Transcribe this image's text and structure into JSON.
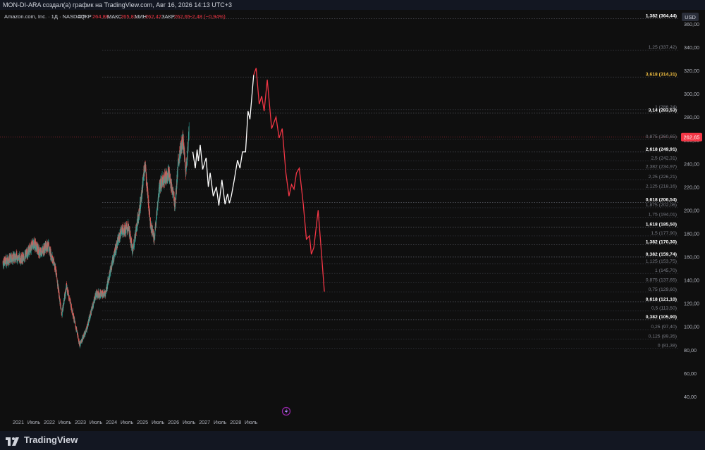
{
  "header": {
    "text": "MON-DI-ARA создал(а) график на TradingView.com, Авг 16, 2026 14:13 UTC+3"
  },
  "legend": {
    "symbol": "Amazon.com, Inc. · 1Д · NASDAQ",
    "open_label": "ОТКР",
    "open_value": "264,88",
    "high_label": "МАКС",
    "high_value": "265,81",
    "low_label": "МИН",
    "low_value": "262,42",
    "close_label": "ЗАКР",
    "close_value": "262,65",
    "change": "−2,48 (−0,94%)"
  },
  "brand": {
    "name": "TradingView"
  },
  "colors": {
    "up": "#26a69a",
    "down": "#ef5350",
    "projection_up": "#ffffff",
    "projection_down": "#f23645",
    "grid_level": "#5d606b",
    "price_badge": "#f23645",
    "golden_label": "#f5c242"
  },
  "chart_data": {
    "type": "line",
    "currency": "USD",
    "ylim": [
      20,
      372
    ],
    "y_ticks": [
      "40,00",
      "60,00",
      "80,00",
      "100,00",
      "120,00",
      "140,00",
      "160,00",
      "180,00",
      "200,00",
      "220,00",
      "240,00",
      "260,00",
      "280,00",
      "300,00",
      "320,00",
      "340,00",
      "360,00"
    ],
    "y_tick_values": [
      40,
      60,
      80,
      100,
      120,
      140,
      160,
      180,
      200,
      220,
      240,
      260,
      280,
      300,
      320,
      340,
      360
    ],
    "x_axis": {
      "range": [
        2020.5,
        2029.5
      ],
      "ticks": [
        {
          "label": "2021",
          "t": 2021.0
        },
        {
          "label": "Июль",
          "t": 2021.5
        },
        {
          "label": "2022",
          "t": 2022.0
        },
        {
          "label": "Июль",
          "t": 2022.5
        },
        {
          "label": "2023",
          "t": 2023.0
        },
        {
          "label": "Июль",
          "t": 2023.5
        },
        {
          "label": "2024",
          "t": 2024.0
        },
        {
          "label": "Июль",
          "t": 2024.5
        },
        {
          "label": "2025",
          "t": 2025.0
        },
        {
          "label": "Июль",
          "t": 2025.5
        },
        {
          "label": "2026",
          "t": 2026.0
        },
        {
          "label": "Июль",
          "t": 2026.5
        },
        {
          "label": "2027",
          "t": 2027.0
        },
        {
          "label": "Июль",
          "t": 2027.5
        },
        {
          "label": "2028",
          "t": 2028.0
        },
        {
          "label": "Июль",
          "t": 2028.5
        }
      ]
    },
    "last_price": {
      "label": "262,65",
      "value": 262.65
    },
    "fib_levels": [
      {
        "label": "1,382 (364,44)",
        "value": 364.44,
        "style": "bold"
      },
      {
        "label": "1,25 (337,42)",
        "value": 337.42,
        "style": "dim"
      },
      {
        "label": "3,618 (314,31)",
        "value": 314.31,
        "style": "gold"
      },
      {
        "label": "1 (286,24)",
        "value": 286.24,
        "style": "dim"
      },
      {
        "label": "3,14 (283,53)",
        "value": 283.53,
        "style": "bold"
      },
      {
        "label": "0,875 (260,65)",
        "value": 260.65,
        "style": "dim"
      },
      {
        "label": "2,618 (249,91)",
        "value": 249.91,
        "style": "bold"
      },
      {
        "label": "2,5 (242,31)",
        "value": 242.31,
        "style": "dim"
      },
      {
        "label": "2,382 (234,97)",
        "value": 234.97,
        "style": "dim"
      },
      {
        "label": "2,25 (226,21)",
        "value": 226.21,
        "style": "dim"
      },
      {
        "label": "2,125 (218,16)",
        "value": 218.16,
        "style": "dim"
      },
      {
        "label": "0,618 (206,54)",
        "value": 206.54,
        "style": "bold"
      },
      {
        "label": "1,875 (202,06)",
        "value": 202.06,
        "style": "dim"
      },
      {
        "label": "1,75 (194,01)",
        "value": 194.01,
        "style": "dim"
      },
      {
        "label": "1,618 (185,50)",
        "value": 185.5,
        "style": "bold"
      },
      {
        "label": "1,5 (177,90)",
        "value": 177.9,
        "style": "dim"
      },
      {
        "label": "1,382 (170,30)",
        "value": 170.3,
        "style": "bold"
      },
      {
        "label": "0,382 (159,74)",
        "value": 159.74,
        "style": "bold"
      },
      {
        "label": "1,125 (153,75)",
        "value": 153.75,
        "style": "dim"
      },
      {
        "label": "1 (145,70)",
        "value": 145.7,
        "style": "dim"
      },
      {
        "label": "0,875 (137,65)",
        "value": 137.65,
        "style": "dim"
      },
      {
        "label": "0,75 (129,60)",
        "value": 129.6,
        "style": "dim"
      },
      {
        "label": "0,618 (121,10)",
        "value": 121.1,
        "style": "bold"
      },
      {
        "label": "0,5 (113,50)",
        "value": 113.5,
        "style": "dim"
      },
      {
        "label": "0,382 (105,90)",
        "value": 105.9,
        "style": "bold"
      },
      {
        "label": "0,25 (97,40)",
        "value": 97.4,
        "style": "dim"
      },
      {
        "label": "0,125 (89,35)",
        "value": 89.35,
        "style": "dim"
      },
      {
        "label": "0 (81,38)",
        "value": 81.38,
        "style": "dim"
      }
    ],
    "series": [
      {
        "name": "",
        "kind": "candles",
        "anchors": [
          {
            "t": 2020.5,
            "v": 155
          },
          {
            "t": 2020.9,
            "v": 160
          },
          {
            "t": 2021.15,
            "v": 158
          },
          {
            "t": 2021.5,
            "v": 172
          },
          {
            "t": 2021.7,
            "v": 163
          },
          {
            "t": 2021.95,
            "v": 170
          },
          {
            "t": 2022.2,
            "v": 150
          },
          {
            "t": 2022.4,
            "v": 110
          },
          {
            "t": 2022.55,
            "v": 135
          },
          {
            "t": 2022.75,
            "v": 112
          },
          {
            "t": 2022.98,
            "v": 84
          },
          {
            "t": 2023.2,
            "v": 98
          },
          {
            "t": 2023.5,
            "v": 128
          },
          {
            "t": 2023.8,
            "v": 128
          },
          {
            "t": 2024.05,
            "v": 158
          },
          {
            "t": 2024.3,
            "v": 182
          },
          {
            "t": 2024.55,
            "v": 185
          },
          {
            "t": 2024.68,
            "v": 165
          },
          {
            "t": 2024.95,
            "v": 208
          },
          {
            "t": 2025.08,
            "v": 240
          },
          {
            "t": 2025.25,
            "v": 190
          },
          {
            "t": 2025.38,
            "v": 175
          },
          {
            "t": 2025.55,
            "v": 222
          },
          {
            "t": 2025.85,
            "v": 232
          },
          {
            "t": 2026.05,
            "v": 205
          },
          {
            "t": 2026.15,
            "v": 240
          },
          {
            "t": 2026.3,
            "v": 262
          },
          {
            "t": 2026.4,
            "v": 232
          },
          {
            "t": 2026.5,
            "v": 268
          }
        ]
      },
      {
        "name": "",
        "kind": "projection",
        "color": "#ffffff",
        "points": [
          {
            "t": 2026.62,
            "v": 250
          },
          {
            "t": 2026.7,
            "v": 236
          },
          {
            "t": 2026.76,
            "v": 252
          },
          {
            "t": 2026.8,
            "v": 242
          },
          {
            "t": 2026.86,
            "v": 256
          },
          {
            "t": 2026.94,
            "v": 235
          },
          {
            "t": 2027.05,
            "v": 245
          },
          {
            "t": 2027.12,
            "v": 220
          },
          {
            "t": 2027.18,
            "v": 232
          },
          {
            "t": 2027.28,
            "v": 212
          },
          {
            "t": 2027.38,
            "v": 220
          },
          {
            "t": 2027.46,
            "v": 204
          },
          {
            "t": 2027.56,
            "v": 226
          },
          {
            "t": 2027.66,
            "v": 205
          },
          {
            "t": 2027.74,
            "v": 214
          },
          {
            "t": 2027.8,
            "v": 206
          },
          {
            "t": 2027.86,
            "v": 212
          },
          {
            "t": 2027.95,
            "v": 225
          },
          {
            "t": 2028.06,
            "v": 243
          },
          {
            "t": 2028.14,
            "v": 236
          },
          {
            "t": 2028.22,
            "v": 250
          },
          {
            "t": 2028.32,
            "v": 250
          },
          {
            "t": 2028.4,
            "v": 285
          },
          {
            "t": 2028.46,
            "v": 278
          },
          {
            "t": 2028.58,
            "v": 316
          }
        ]
      },
      {
        "name": "",
        "kind": "projection",
        "color": "#f23645",
        "points": [
          {
            "t": 2028.58,
            "v": 316
          },
          {
            "t": 2028.66,
            "v": 322
          },
          {
            "t": 2028.76,
            "v": 291
          },
          {
            "t": 2028.84,
            "v": 298
          },
          {
            "t": 2028.92,
            "v": 285
          },
          {
            "t": 2029.02,
            "v": 312
          },
          {
            "t": 2029.16,
            "v": 270
          },
          {
            "t": 2029.3,
            "v": 280
          },
          {
            "t": 2029.4,
            "v": 262
          },
          {
            "t": 2029.5,
            "v": 270
          },
          {
            "t": 2029.62,
            "v": 232
          },
          {
            "t": 2029.72,
            "v": 212
          },
          {
            "t": 2029.8,
            "v": 222
          },
          {
            "t": 2029.88,
            "v": 218
          },
          {
            "t": 2029.96,
            "v": 232
          },
          {
            "t": 2030.05,
            "v": 236
          },
          {
            "t": 2030.18,
            "v": 205
          },
          {
            "t": 2030.28,
            "v": 175
          },
          {
            "t": 2030.38,
            "v": 178
          },
          {
            "t": 2030.44,
            "v": 162
          },
          {
            "t": 2030.52,
            "v": 168
          },
          {
            "t": 2030.66,
            "v": 200
          },
          {
            "t": 2030.86,
            "v": 130
          }
        ]
      }
    ]
  }
}
